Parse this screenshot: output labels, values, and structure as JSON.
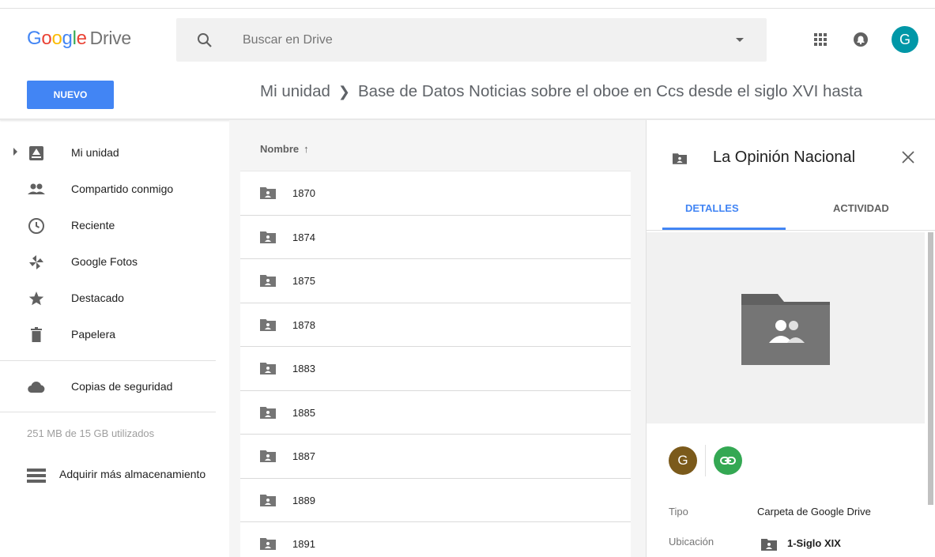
{
  "header": {
    "logo_letters": [
      "G",
      "o",
      "o",
      "g",
      "l",
      "e"
    ],
    "logo_product": "Drive",
    "search_placeholder": "Buscar en Drive",
    "user_initial": "G"
  },
  "toolbar": {
    "new_label": "NUEVO",
    "breadcrumb_root": "Mi unidad",
    "breadcrumb_current": "Base de Datos Noticias sobre el oboe en Ccs desde el siglo XVI hasta"
  },
  "sidebar": {
    "items": [
      {
        "label": "Mi unidad",
        "icon": "my-drive-icon"
      },
      {
        "label": "Compartido conmigo",
        "icon": "shared-people-icon"
      },
      {
        "label": "Reciente",
        "icon": "clock-icon"
      },
      {
        "label": "Google Fotos",
        "icon": "pinwheel-icon"
      },
      {
        "label": "Destacado",
        "icon": "star-icon"
      },
      {
        "label": "Papelera",
        "icon": "trash-icon"
      }
    ],
    "backups_label": "Copias de seguridad",
    "storage_text": "251 MB de 15 GB utilizados",
    "buy_storage_label": "Adquirir más almacenamiento"
  },
  "list": {
    "column_name": "Nombre",
    "sort_arrow": "↑",
    "rows": [
      "1870",
      "1874",
      "1875",
      "1878",
      "1883",
      "1885",
      "1887",
      "1889",
      "1891"
    ]
  },
  "details": {
    "title": "La Opinión Nacional",
    "tab_details": "DETALLES",
    "tab_activity": "ACTIVIDAD",
    "owner_initial": "G",
    "type_label": "Tipo",
    "type_value": "Carpeta de Google Drive",
    "location_label": "Ubicación",
    "location_value": "1-Siglo XIX"
  },
  "colors": {
    "accent": "#4285f4",
    "avatar_top": "#0097a7",
    "owner_avatar": "#7b5a1b",
    "link_green": "#34a853"
  }
}
